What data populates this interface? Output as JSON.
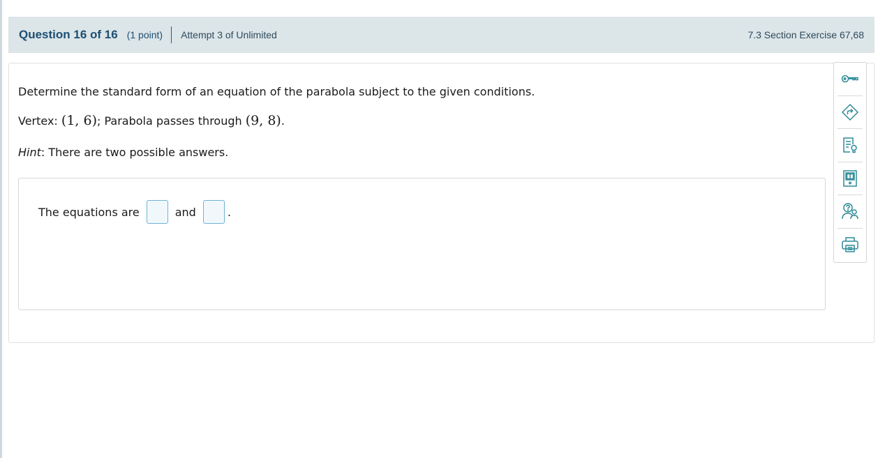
{
  "header": {
    "question_label": "Question 16 of 16",
    "points": "(1 point)",
    "attempt": "Attempt 3 of Unlimited",
    "section": "7.3 Section Exercise 67,68"
  },
  "question": {
    "prompt": "Determine the standard form of an equation of the parabola subject to the given conditions.",
    "vertex_prefix": "Vertex: ",
    "vertex_math": "(1, 6)",
    "passes_text": "; Parabola passes through ",
    "point_math": "(9, 8)",
    "period": ".",
    "hint_label": "Hint",
    "hint_text": ": There are two possible answers."
  },
  "answer": {
    "prefix": "The equations are",
    "and": "and",
    "suffix": ".",
    "input1_value": "",
    "input2_value": ""
  },
  "toolbar": {
    "items": [
      "key-icon",
      "directions-icon",
      "notes-lightbulb-icon",
      "textbook-icon",
      "help-person-icon",
      "print-icon"
    ],
    "icon_color": "#2d8a97"
  }
}
